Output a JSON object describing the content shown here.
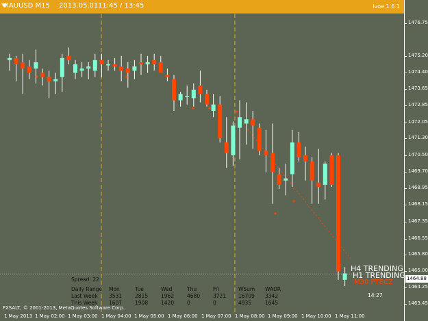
{
  "topbar": {
    "symbol": "XAUUSD M15",
    "date": "2013.05.01",
    "time": "11:45 / 13:45",
    "version": "ivoe 1.6.1"
  },
  "price_axis": {
    "labels": [
      "1476.75",
      "1475.20",
      "1474.40",
      "1473.65",
      "1472.85",
      "1472.05",
      "1471.30",
      "1470.50",
      "1469.70",
      "1468.95",
      "1468.15",
      "1467.35",
      "1466.55",
      "1465.80",
      "1465.00",
      "1464.25",
      "1463.45"
    ],
    "current_price": "1464.88"
  },
  "time_axis": {
    "labels": [
      "1 May 2013",
      "1 May 02:00",
      "1 May 03:00",
      "1 May 04:00",
      "1 May 05:00",
      "1 May 06:00",
      "1 May 07:00",
      "1 May 08:00",
      "1 May 09:00",
      "1 May 10:00",
      "1 May 11:00"
    ]
  },
  "footer": {
    "copyright": "FXSALT, © 2001-2013, MetaQuotes Software Corp."
  },
  "stats": {
    "spread_label": "Spread: 22",
    "headers": [
      "Daily Range",
      "Mon",
      "Tue",
      "Wed",
      "Thu",
      "Fri",
      "WSum",
      "WADR"
    ],
    "rows": [
      [
        "Last Week",
        "3531",
        "2815",
        "1962",
        "4680",
        "3721",
        "16709",
        "3342"
      ],
      [
        "This Week",
        "1607",
        "1908",
        "1420",
        "0",
        "0",
        "4935",
        "1645"
      ]
    ]
  },
  "trend": {
    "h4": "H4 TRENDING",
    "h1": "H1 TRENDING",
    "m30": "M30 PTECZ"
  },
  "bar_timer": "14:27",
  "colors": {
    "background": "#5c6453",
    "bull": "#7fffd4",
    "bear": "#ff4500",
    "topbar": "#e8a318",
    "separator": "#e8a318"
  },
  "chart_data": {
    "type": "candlestick",
    "title": "XAUUSD M15",
    "y_range": [
      1463.2,
      1477.2
    ],
    "candles": [
      [
        1475.0,
        1475.3,
        1474.5,
        1475.1
      ],
      [
        1475.1,
        1475.2,
        1474.0,
        1474.8
      ],
      [
        1474.9,
        1475.3,
        1473.4,
        1474.6
      ],
      [
        1474.7,
        1475.0,
        1474.1,
        1474.4
      ],
      [
        1474.6,
        1475.5,
        1473.9,
        1474.9
      ],
      [
        1474.4,
        1474.6,
        1473.8,
        1474.2
      ],
      [
        1474.2,
        1474.5,
        1473.2,
        1474.0
      ],
      [
        1474.0,
        1474.4,
        1473.4,
        1474.1
      ],
      [
        1474.2,
        1475.3,
        1473.5,
        1475.1
      ],
      [
        1475.2,
        1475.6,
        1474.8,
        1475.0
      ],
      [
        1474.4,
        1475.0,
        1474.1,
        1474.8
      ],
      [
        1474.5,
        1474.9,
        1474.2,
        1474.6
      ],
      [
        1474.6,
        1474.9,
        1474.1,
        1474.7
      ],
      [
        1474.5,
        1475.3,
        1474.2,
        1475.0
      ],
      [
        1475.0,
        1475.3,
        1474.2,
        1474.8
      ],
      [
        1474.8,
        1475.0,
        1474.5,
        1474.8
      ],
      [
        1474.8,
        1475.1,
        1474.5,
        1474.7
      ],
      [
        1474.7,
        1475.2,
        1474.0,
        1474.5
      ],
      [
        1474.6,
        1474.9,
        1473.7,
        1474.4
      ],
      [
        1474.5,
        1475.0,
        1474.1,
        1474.7
      ],
      [
        1474.9,
        1475.3,
        1474.3,
        1474.8
      ],
      [
        1474.8,
        1475.2,
        1474.4,
        1474.9
      ],
      [
        1475.0,
        1475.3,
        1474.5,
        1474.8
      ],
      [
        1474.9,
        1475.2,
        1474.6,
        1474.4
      ],
      [
        1474.3,
        1474.6,
        1474.0,
        1474.2
      ],
      [
        1474.1,
        1474.3,
        1472.6,
        1473.1
      ],
      [
        1473.1,
        1473.5,
        1472.8,
        1473.4
      ],
      [
        1473.3,
        1473.8,
        1472.9,
        1473.3
      ],
      [
        1473.2,
        1473.9,
        1472.8,
        1473.6
      ],
      [
        1473.8,
        1474.5,
        1473.0,
        1473.4
      ],
      [
        1473.4,
        1473.6,
        1472.8,
        1472.9
      ],
      [
        1472.6,
        1473.4,
        1472.3,
        1472.9
      ],
      [
        1472.9,
        1473.3,
        1471.1,
        1471.3
      ],
      [
        1471.1,
        1472.3,
        1469.9,
        1470.6
      ],
      [
        1470.5,
        1472.1,
        1470.0,
        1471.9
      ],
      [
        1471.8,
        1473.1,
        1470.3,
        1472.3
      ],
      [
        1472.0,
        1473.0,
        1471.0,
        1472.2
      ],
      [
        1472.2,
        1472.6,
        1470.8,
        1471.9
      ],
      [
        1471.8,
        1472.0,
        1470.5,
        1470.7
      ],
      [
        1470.7,
        1471.7,
        1469.7,
        1470.5
      ],
      [
        1470.6,
        1472.0,
        1468.2,
        1469.7
      ],
      [
        1469.6,
        1469.9,
        1468.9,
        1469.1
      ],
      [
        1469.3,
        1470.1,
        1468.6,
        1469.4
      ],
      [
        1469.6,
        1471.7,
        1469.0,
        1471.1
      ],
      [
        1471.1,
        1471.6,
        1470.2,
        1470.4
      ],
      [
        1470.5,
        1470.9,
        1469.3,
        1470.2
      ],
      [
        1470.2,
        1470.4,
        1468.2,
        1469.3
      ],
      [
        1469.2,
        1470.8,
        1468.2,
        1469.0
      ],
      [
        1469.1,
        1470.2,
        1468.4,
        1470.1
      ],
      [
        1470.5,
        1470.6,
        1469.0,
        1469.1
      ],
      [
        1470.5,
        1470.6,
        1464.6,
        1465.0
      ],
      [
        1464.6,
        1465.2,
        1464.3,
        1464.9
      ]
    ]
  }
}
